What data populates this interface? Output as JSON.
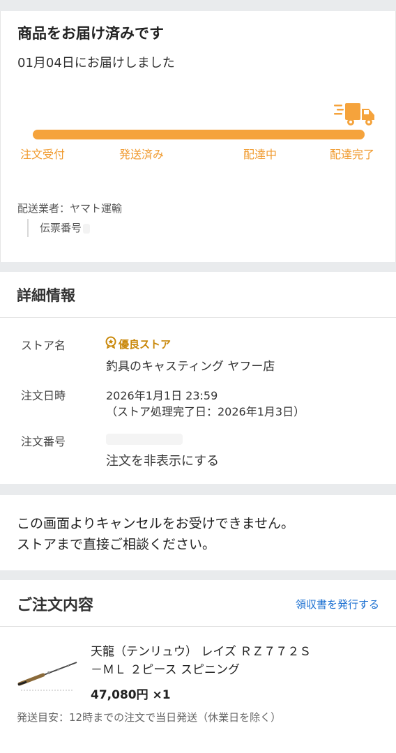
{
  "status": {
    "title": "商品をお届け済みです",
    "delivered_text": "01月04日にお届けしました",
    "progress": 1.0,
    "steps": [
      "注文受付",
      "発送済み",
      "配達中",
      "配達完了"
    ],
    "accent_color": "#f5a33c",
    "carrier_text": "配送業者：ヤマト運輸",
    "slip_label": "伝票番号"
  },
  "detail": {
    "title": "詳細情報",
    "store_label": "ストア名",
    "store_badge": "優良ストア",
    "store_name": "釣具のキャスティング ヤフー店",
    "date_label": "注文日時",
    "date_value": "2026年1月1日 23:59",
    "date_note": "（ストア処理完了日：2026年1月3日）",
    "order_no_label": "注文番号",
    "hide_link": "注文を非表示にする"
  },
  "notice": {
    "line1": "この画面よりキャンセルをお受けできません。",
    "line2": "ストアまで直接ご相談ください。"
  },
  "order": {
    "title": "ご注文内容",
    "receipt_link": "領収書を発行する",
    "product_line1": "天龍（テンリュウ） レイズ ＲＺ７７２Ｓ",
    "product_line2": "－ＭＬ ２ピース スピニング",
    "price": "47,080円 ×1",
    "ship_note": "発送目安：12時までの注文で当日発送（休業日を除く）"
  }
}
